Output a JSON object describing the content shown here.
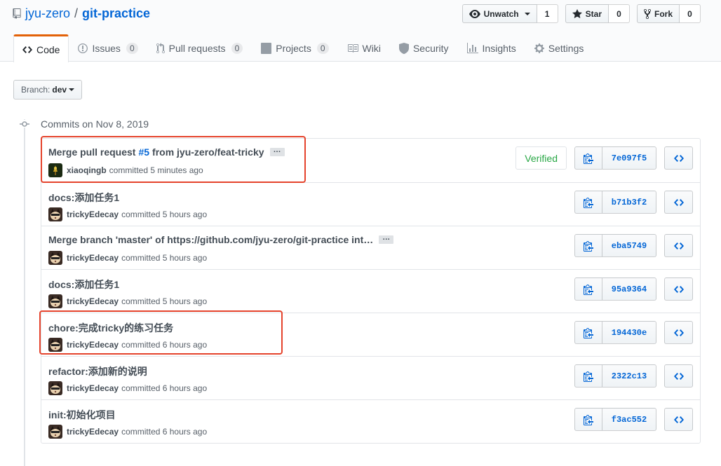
{
  "repo": {
    "owner": "jyu-zero",
    "separator": "/",
    "name": "git-practice"
  },
  "actions": {
    "watch_label": "Unwatch",
    "watch_count": "1",
    "star_label": "Star",
    "star_count": "0",
    "fork_label": "Fork",
    "fork_count": "0"
  },
  "nav": {
    "code": "Code",
    "issues": "Issues",
    "issues_count": "0",
    "pulls": "Pull requests",
    "pulls_count": "0",
    "projects": "Projects",
    "projects_count": "0",
    "wiki": "Wiki",
    "security": "Security",
    "insights": "Insights",
    "settings": "Settings"
  },
  "branch": {
    "label": "Branch:",
    "value": "dev"
  },
  "commit_group_title": "Commits on Nov 8, 2019",
  "verified_label": "Verified",
  "commits": [
    {
      "title_prefix": "Merge pull request",
      "title_link": "#5",
      "title_suffix": "from jyu-zero/feat-tricky",
      "author": "xiaoqingb",
      "committed": "committed 5 minutes ago",
      "sha": "7e097f5"
    },
    {
      "title": "docs:添加任务1",
      "author": "trickyEdecay",
      "committed": "committed 5 hours ago",
      "sha": "b71b3f2"
    },
    {
      "title": "Merge branch 'master' of https://github.com/jyu-zero/git-practice int…",
      "author": "trickyEdecay",
      "committed": "committed 5 hours ago",
      "sha": "eba5749"
    },
    {
      "title": "docs:添加任务1",
      "author": "trickyEdecay",
      "committed": "committed 5 hours ago",
      "sha": "95a9364"
    },
    {
      "title": "chore:完成tricky的练习任务",
      "author": "trickyEdecay",
      "committed": "committed 6 hours ago",
      "sha": "194430e"
    },
    {
      "title": "refactor:添加新的说明",
      "author": "trickyEdecay",
      "committed": "committed 6 hours ago",
      "sha": "2322c13"
    },
    {
      "title": "init:初始化项目",
      "author": "trickyEdecay",
      "committed": "committed 6 hours ago",
      "sha": "f3ac552"
    }
  ],
  "colors": {
    "link": "#0366d6",
    "verified": "#28a745",
    "selected_tab_accent": "#e36209",
    "annotation": "#e5432c"
  }
}
